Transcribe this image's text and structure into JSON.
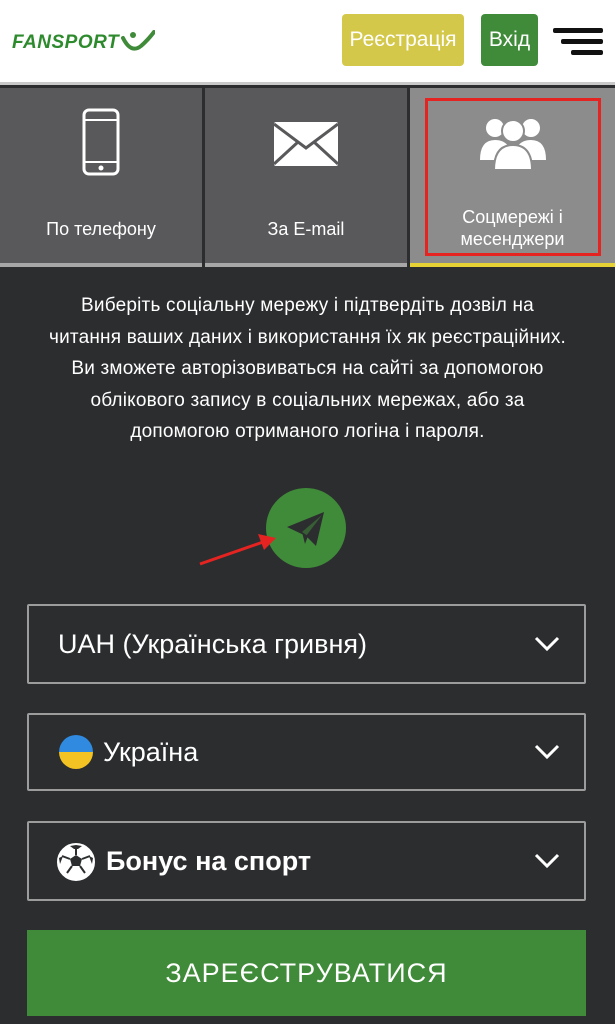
{
  "header": {
    "logo_text": "FANSPORT",
    "register_label": "Реєстрація",
    "login_label": "Вхід",
    "brand_green": "#3f8b39",
    "register_color": "#d4c84a"
  },
  "tabs": [
    {
      "label": "По телефону",
      "icon": "phone-icon"
    },
    {
      "label": "За E-mail",
      "icon": "envelope-icon"
    },
    {
      "label_line1": "Соцмережі і",
      "label_line2": "месенджери",
      "icon": "users-icon",
      "active": true
    }
  ],
  "description": {
    "line1": "Виберіть соціальну мережу і підтвердіть дозвіл на",
    "line2": "читання ваших даних і використання їх як реєстраційних.",
    "line3": "Ви зможете авторізовиватьcя на сайті за допомогою",
    "line4": "облікового запису в соціальних мережах, або за",
    "line5": "допомогою отриманого логіна і пароля."
  },
  "social": {
    "icon": "telegram-icon"
  },
  "form": {
    "currency": "UAH (Українська гривня)",
    "country": "Україна",
    "bonus": "Бонус на спорт",
    "submit_label": "ЗАРЕЄСТРУВАТИСЯ"
  }
}
